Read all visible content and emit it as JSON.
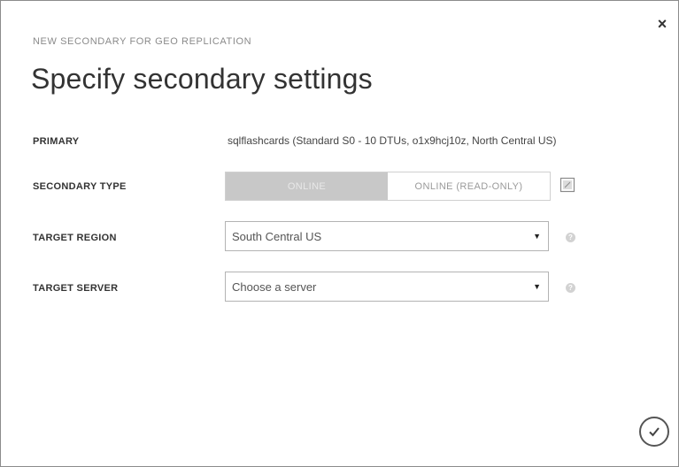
{
  "dialog": {
    "subtitle": "NEW SECONDARY FOR GEO REPLICATION",
    "title": "Specify secondary settings",
    "close_glyph": "×"
  },
  "fields": {
    "primary": {
      "label": "PRIMARY",
      "value": "sqlflashcards (Standard S0 - 10 DTUs, o1x9hcj10z, North Central US)"
    },
    "secondary_type": {
      "label": "SECONDARY TYPE",
      "options": [
        "ONLINE",
        "ONLINE (READ-ONLY)"
      ],
      "selected": "ONLINE"
    },
    "target_region": {
      "label": "TARGET REGION",
      "value": "South Central US",
      "help_glyph": "?"
    },
    "target_server": {
      "label": "TARGET SERVER",
      "value": "Choose a server",
      "help_glyph": "?"
    }
  },
  "icons": {
    "close": "close-icon",
    "info_box": "info-box-icon",
    "help": "help-icon",
    "confirm": "checkmark-icon"
  },
  "colors": {
    "active_toggle": "#c8c8c8",
    "border": "#b3b3b3",
    "help_icon": "#d2d2d2"
  }
}
